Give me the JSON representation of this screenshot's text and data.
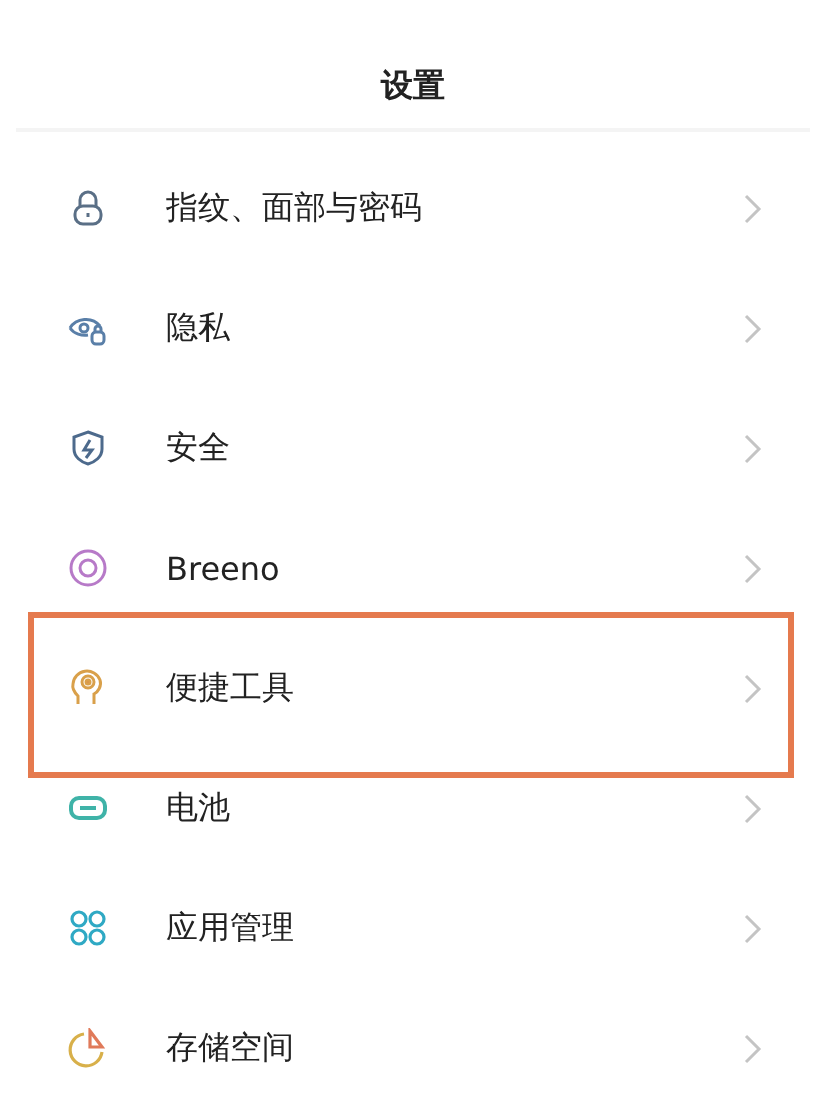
{
  "title": "设置",
  "items": [
    {
      "label": "指纹、面部与密码",
      "highlighted": false
    },
    {
      "label": "隐私",
      "highlighted": false
    },
    {
      "label": "安全",
      "highlighted": false
    },
    {
      "label": "Breeno",
      "highlighted": false
    },
    {
      "label": "便捷工具",
      "highlighted": true
    },
    {
      "label": "电池",
      "highlighted": false
    },
    {
      "label": "应用管理",
      "highlighted": false
    },
    {
      "label": "存储空间",
      "highlighted": false
    }
  ]
}
